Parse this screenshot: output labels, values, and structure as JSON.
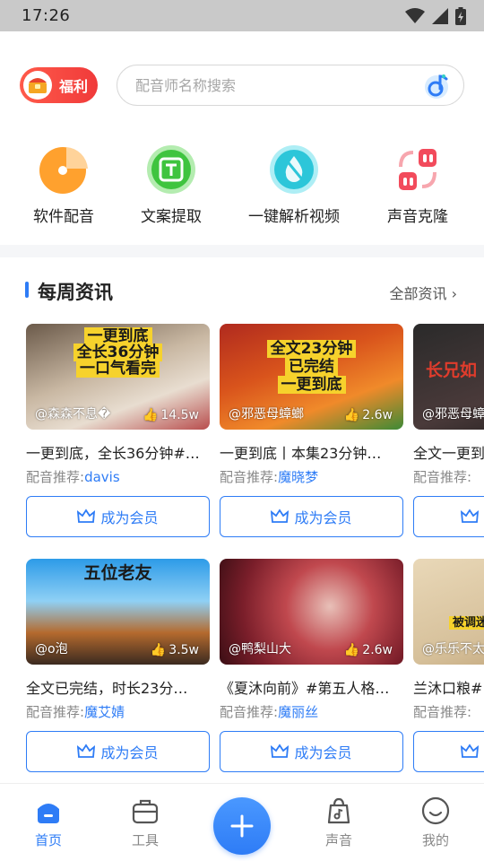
{
  "status_bar": {
    "time": "17:26"
  },
  "header": {
    "welfare_label": "福利",
    "search_placeholder": "配音师名称搜索"
  },
  "shortcuts": [
    {
      "label": "软件配音",
      "icon": "pie-chart-icon",
      "color": "#ffa12e"
    },
    {
      "label": "文案提取",
      "icon": "text-extract-icon",
      "color": "#3fc43f"
    },
    {
      "label": "一键解析视频",
      "icon": "water-drop-icon",
      "color": "#2cc6d9"
    },
    {
      "label": "声音克隆",
      "icon": "clone-arrows-icon",
      "color": "#f24b5c"
    }
  ],
  "news": {
    "title": "每周资讯",
    "all_link": "全部资讯",
    "recommend_prefix": "配音推荐:",
    "vip_label": "成为会员",
    "cards": [
      {
        "author": "@森森不息�",
        "likes": "14.5w",
        "title": "一更到底，全长36分钟#…",
        "voice": "davis",
        "caption": [
          "一更到底",
          "全长36分钟",
          "一口气看完"
        ]
      },
      {
        "author": "@邪恶母蟑螂",
        "likes": "2.6w",
        "title": "一更到底丨本集23分钟…",
        "voice": "魔晓梦",
        "caption": [
          "全文23分钟",
          "已完结",
          "一更到底"
        ]
      },
      {
        "author": "@邪恶母蟑",
        "likes": "",
        "title": "全文一更到",
        "voice": "",
        "caption": [
          "长兄如"
        ]
      },
      {
        "author": "@o泡",
        "likes": "3.5w",
        "title": "全文已完结，时长23分…",
        "voice": "魔艾婧",
        "caption": [
          "五位老友"
        ]
      },
      {
        "author": "@鸭梨山大",
        "likes": "2.6w",
        "title": "《夏沐向前》#第五人格…",
        "voice": "魔丽丝",
        "caption": []
      },
      {
        "author": "@乐乐不太",
        "likes": "",
        "title": "兰沐口粮#",
        "voice": "",
        "caption": [
          "被调迷"
        ]
      }
    ]
  },
  "bottom_nav": [
    {
      "label": "首页",
      "icon": "home-icon",
      "active": true
    },
    {
      "label": "工具",
      "icon": "toolbox-icon",
      "active": false
    },
    {
      "label": "",
      "icon": "plus-icon",
      "active": false
    },
    {
      "label": "声音",
      "icon": "music-bag-icon",
      "active": false
    },
    {
      "label": "我的",
      "icon": "smile-icon",
      "active": false
    }
  ],
  "colors": {
    "accent": "#2e7cf6",
    "welfare": "#f03a3a"
  }
}
